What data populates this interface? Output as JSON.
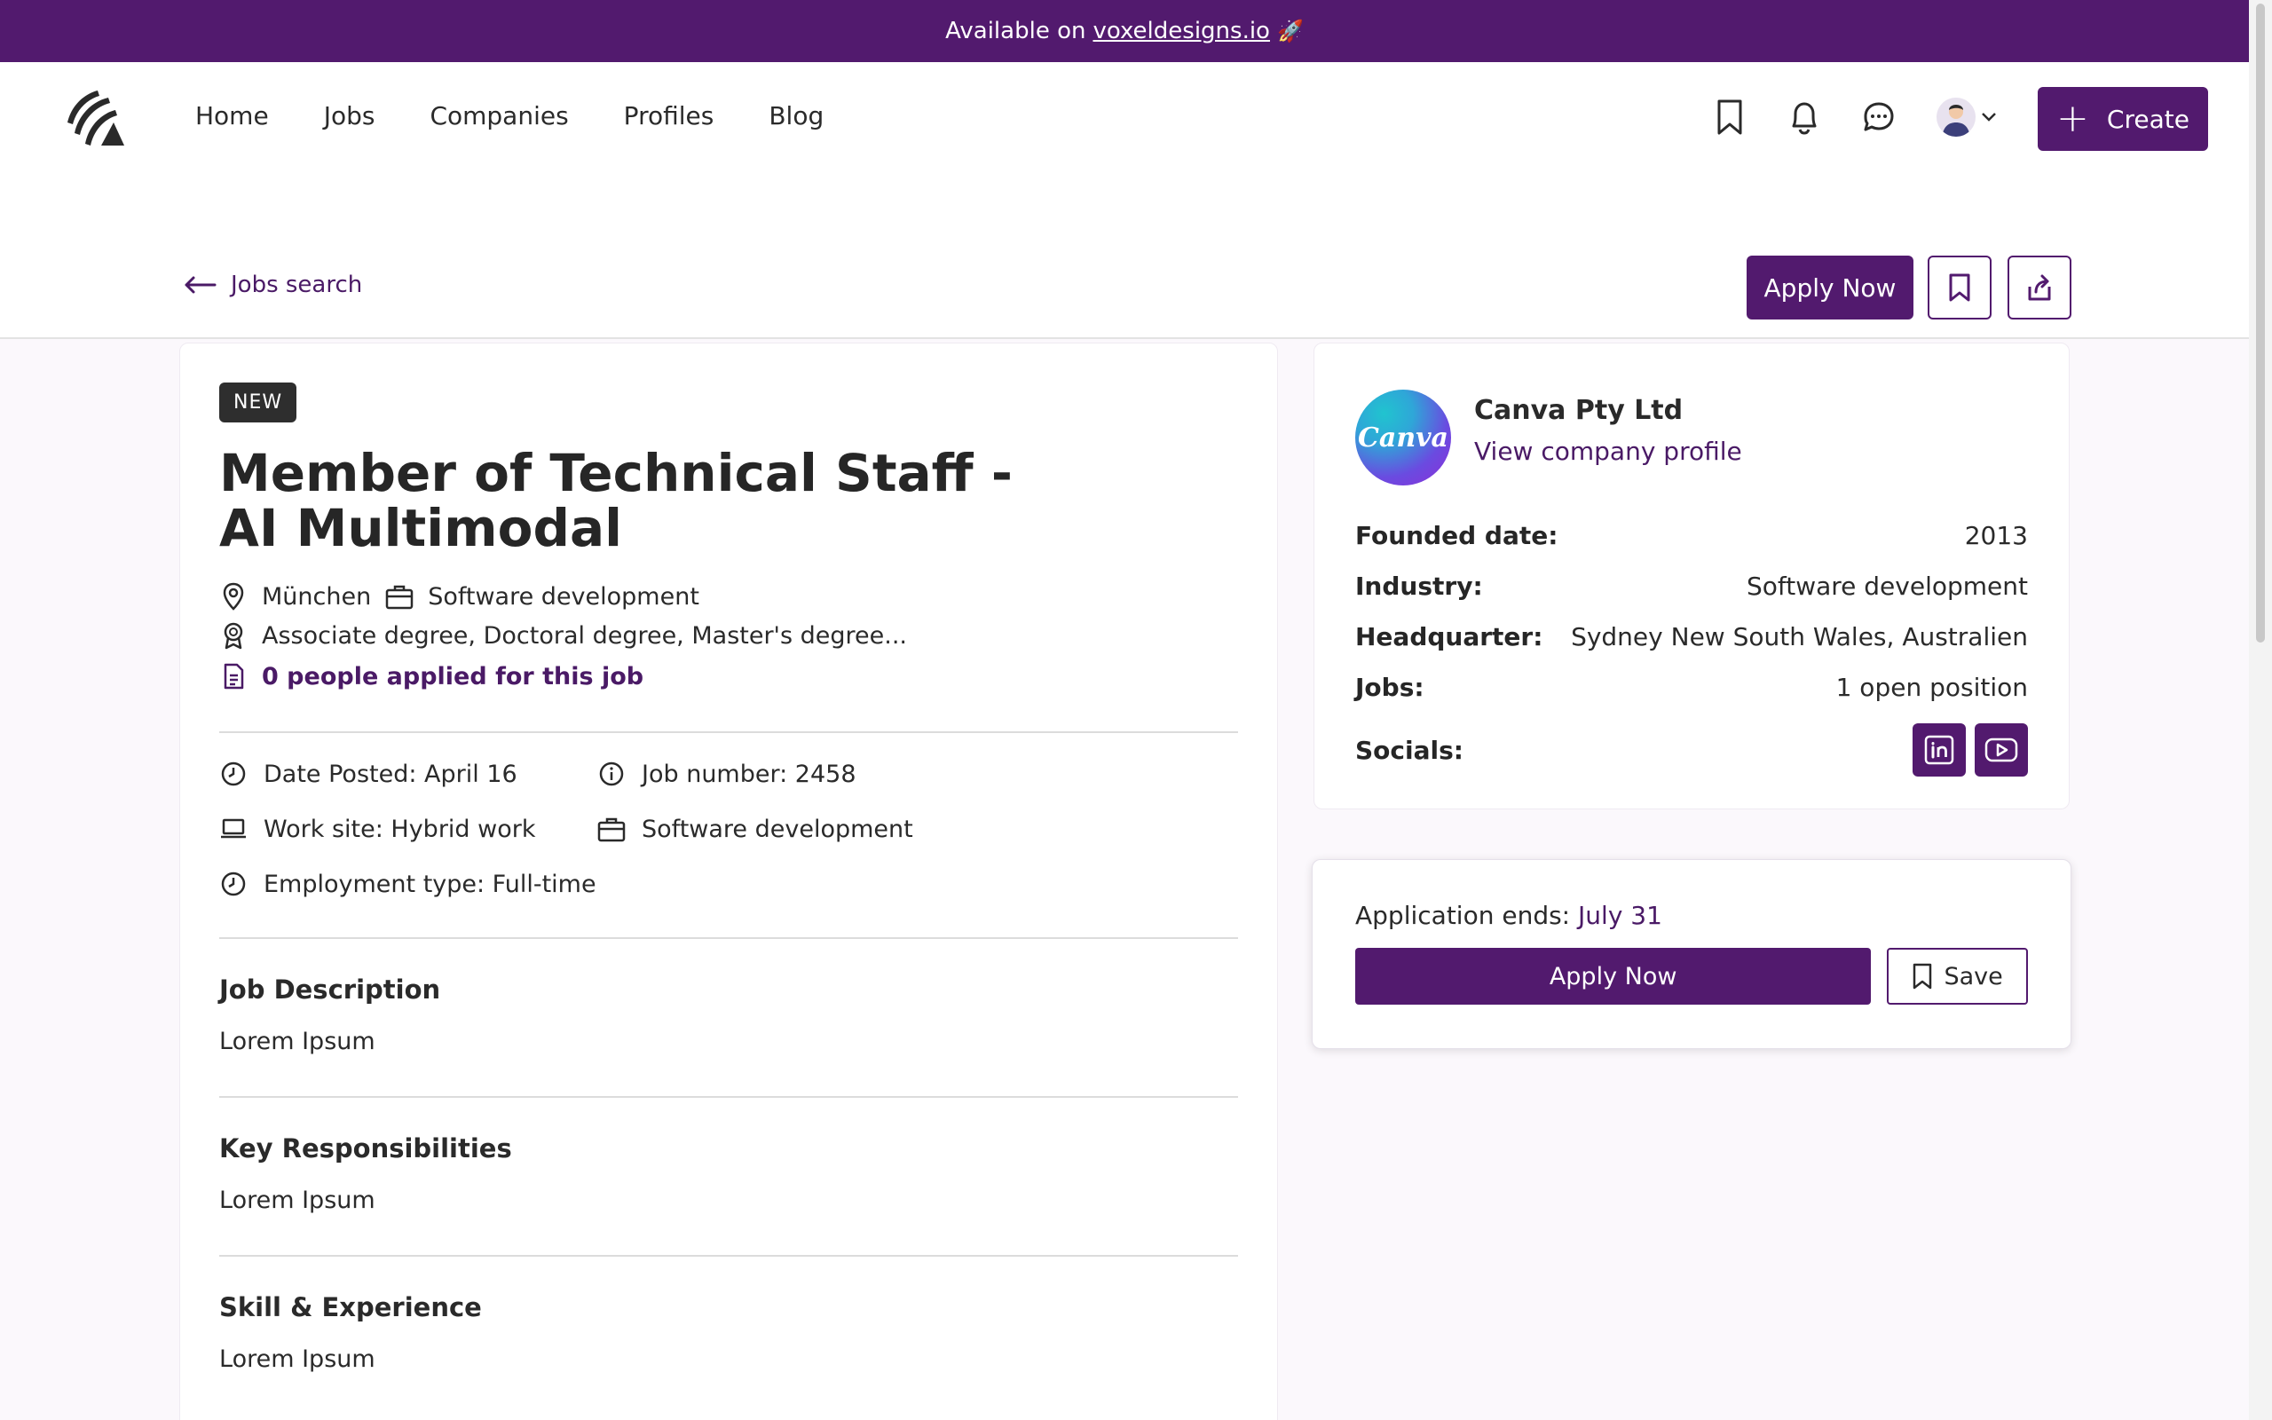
{
  "banner": {
    "prefix": "Available on",
    "link": "voxeldesigns.io",
    "emoji": "🚀"
  },
  "nav": {
    "links": [
      "Home",
      "Jobs",
      "Companies",
      "Profiles",
      "Blog"
    ],
    "create_label": "Create"
  },
  "subbar": {
    "back_label": "Jobs search",
    "apply_label": "Apply Now"
  },
  "job": {
    "badge": "NEW",
    "title": "Member of Technical Staff - AI Multimodal",
    "location": "München",
    "category": "Software development",
    "degrees": "Associate degree, Doctoral degree, Master's degree...",
    "applied": "0 people applied for this job",
    "facts": {
      "date_posted": "Date Posted: April 16",
      "job_number": "Job number: 2458",
      "work_site": "Work site: Hybrid work",
      "field": "Software development",
      "employment": "Employment type: Full-time"
    },
    "sections": [
      {
        "title": "Job Description",
        "body": "Lorem Ipsum"
      },
      {
        "title": "Key Responsibilities",
        "body": "Lorem Ipsum"
      },
      {
        "title": "Skill & Experience",
        "body": "Lorem Ipsum"
      }
    ]
  },
  "company": {
    "logo_text": "Canva",
    "name": "Canva Pty Ltd",
    "profile_link": "View company profile",
    "rows": {
      "founded_k": "Founded date:",
      "founded_v": "2013",
      "industry_k": "Industry:",
      "industry_v": "Software development",
      "hq_k": "Headquarter:",
      "hq_v": "Sydney New South Wales, Australien",
      "jobs_k": "Jobs:",
      "jobs_v": "1 open position",
      "socials_k": "Socials:"
    }
  },
  "application": {
    "ends_label": "Application ends:",
    "ends_date": "July 31",
    "apply_label": "Apply Now",
    "save_label": "Save"
  },
  "colors": {
    "brand": "#521a6e",
    "link": "#4a1a66"
  }
}
